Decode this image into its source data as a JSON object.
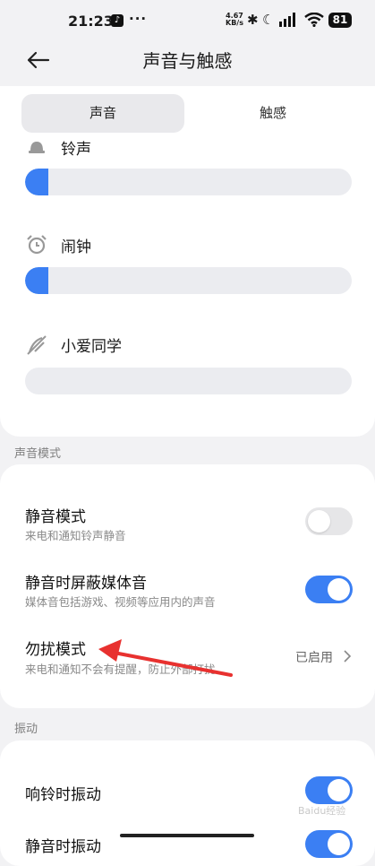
{
  "status_bar": {
    "time": "21:23",
    "more": "···",
    "net_speed_value": "4.67",
    "net_speed_unit": "KB/s",
    "battery": "81"
  },
  "header": {
    "title": "声音与触感"
  },
  "tabs": [
    {
      "label": "声音",
      "active": true
    },
    {
      "label": "触感",
      "active": false
    }
  ],
  "volume": {
    "items": [
      {
        "label": "铃声",
        "level": 0.07
      },
      {
        "label": "闹钟",
        "level": 0.07
      },
      {
        "label": "小爱同学",
        "level": 0.0
      }
    ]
  },
  "sound_mode": {
    "section_title": "声音模式",
    "items": [
      {
        "title": "静音模式",
        "subtitle": "来电和通知铃声静音",
        "enabled": false
      },
      {
        "title": "静音时屏蔽媒体音",
        "subtitle": "媒体音包括游戏、视频等应用内的声音",
        "enabled": true
      },
      {
        "title": "勿扰模式",
        "subtitle": "来电和通知不会有提醒，防止外部打扰",
        "status": "已启用"
      }
    ]
  },
  "vibration": {
    "section_title": "振动",
    "items": [
      {
        "title": "响铃时振动",
        "enabled": true
      },
      {
        "title": "静音时振动",
        "enabled": true
      }
    ]
  },
  "watermark": "Baidu经验",
  "colors": {
    "accent": "#3b7ff3",
    "annotation_arrow": "#e8312f"
  }
}
